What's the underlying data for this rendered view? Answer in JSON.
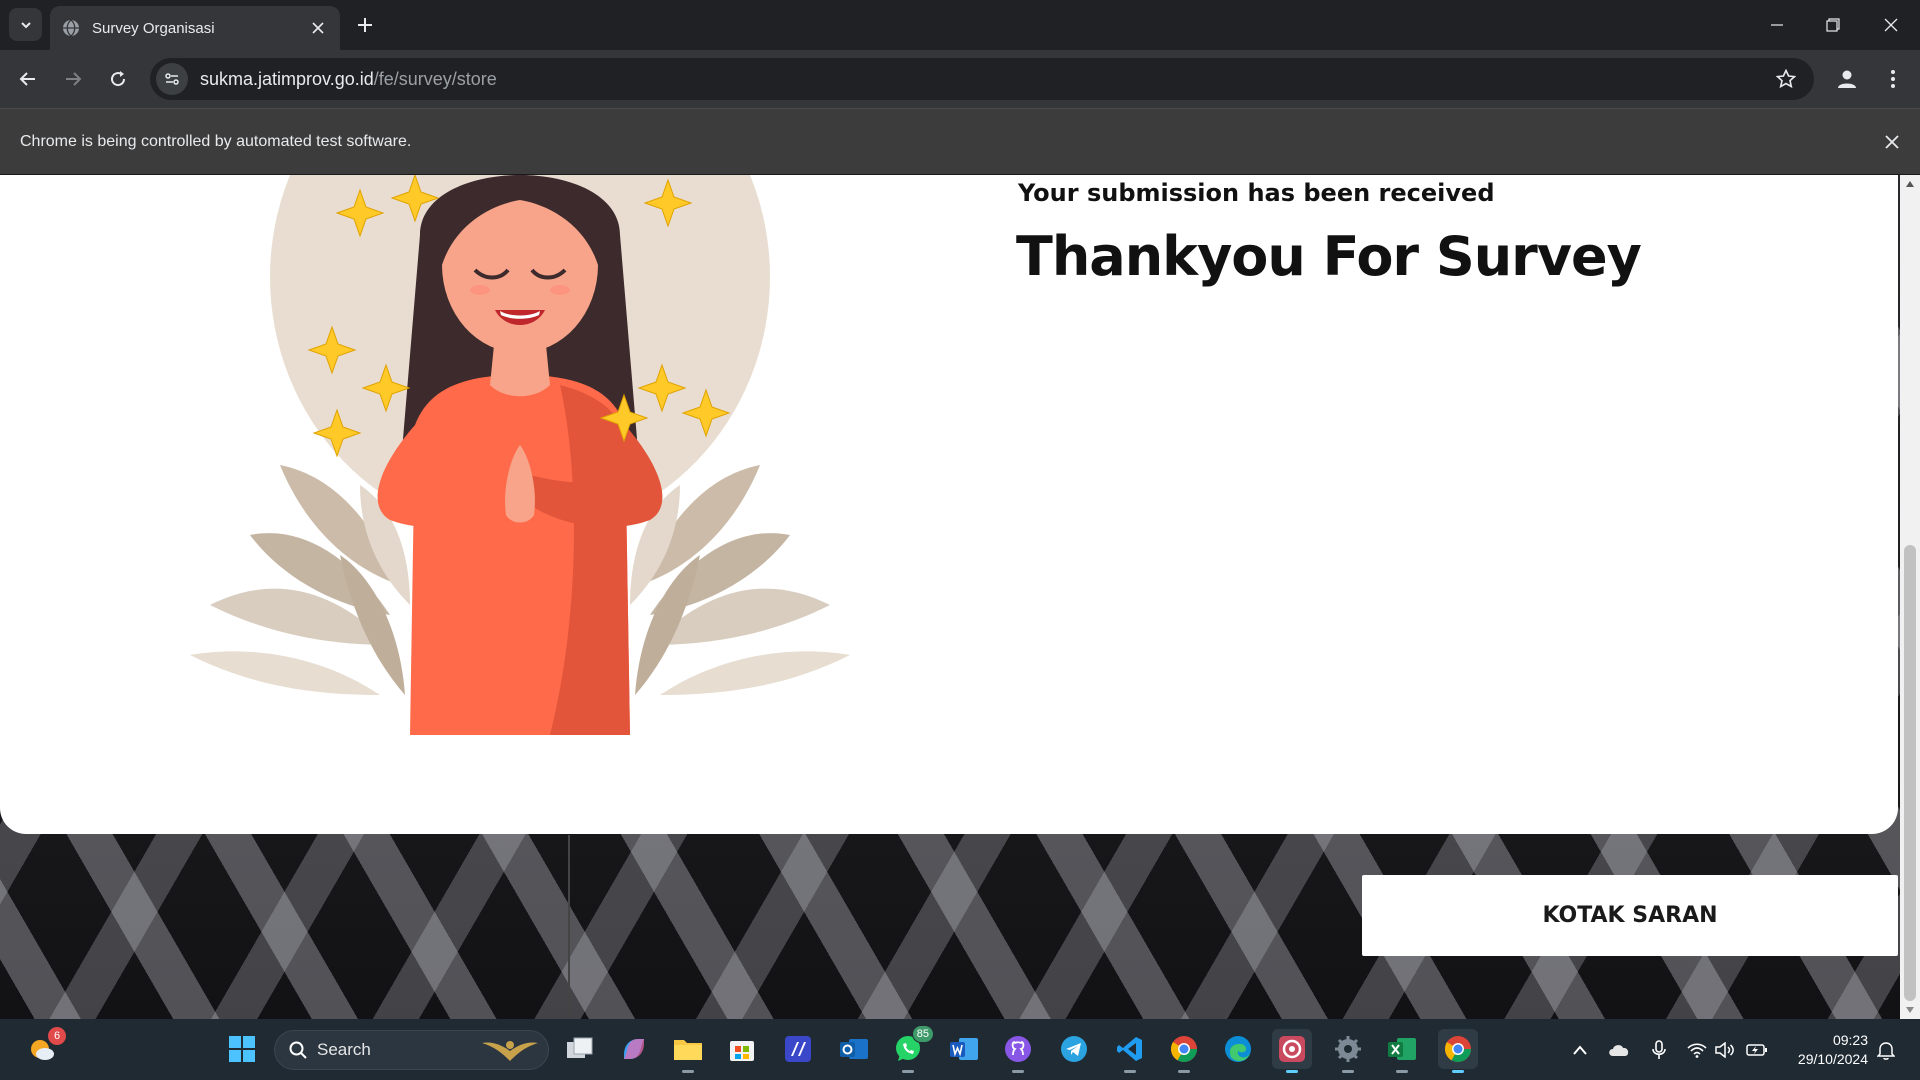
{
  "browser": {
    "tab_title": "Survey Organisasi",
    "url_host": "sukma.jatimprov.go.id",
    "url_path": "/fe/survey/store",
    "infobar_text": "Chrome is being controlled by automated test software."
  },
  "page": {
    "subtitle": "Your submission has been received",
    "title": "Thankyou For Survey",
    "suggestion_button": "KOTAK SARAN"
  },
  "taskbar": {
    "search_label": "Search",
    "weather_badge": "6",
    "whatsapp_badge": "85",
    "time": "09:23",
    "date": "29/10/2024"
  },
  "colors": {
    "dress": "#ff6b4a",
    "halo": "#e8ddd0",
    "sparkle": "#ffc928",
    "hair": "#3d2a2c"
  }
}
